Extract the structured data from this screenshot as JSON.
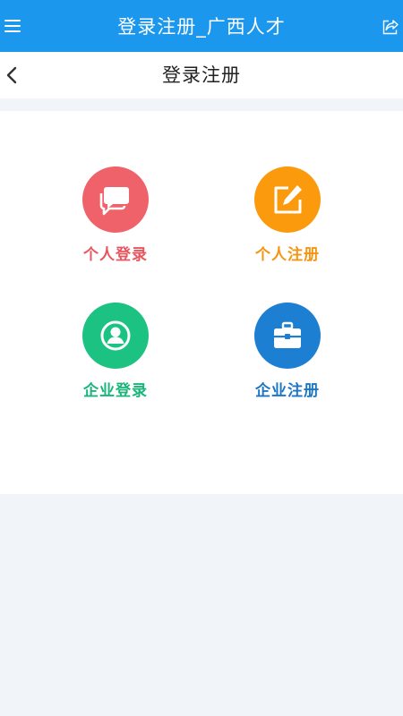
{
  "app_bar": {
    "title": "登录注册_广西人才",
    "menu_icon": "hamburger-menu-icon",
    "share_icon": "share-icon",
    "bg_color": "#1b97ee"
  },
  "nav": {
    "title": "登录注册",
    "back_icon": "chevron-left-icon"
  },
  "options": [
    {
      "label": "个人登录",
      "icon": "chat-bubbles-icon",
      "color": "#f0626a"
    },
    {
      "label": "个人注册",
      "icon": "edit-document-icon",
      "color": "#fb9a0c"
    },
    {
      "label": "企业登录",
      "icon": "user-avatar-icon",
      "color": "#1cc282"
    },
    {
      "label": "企业注册",
      "icon": "briefcase-icon",
      "color": "#1d7fd2"
    }
  ]
}
